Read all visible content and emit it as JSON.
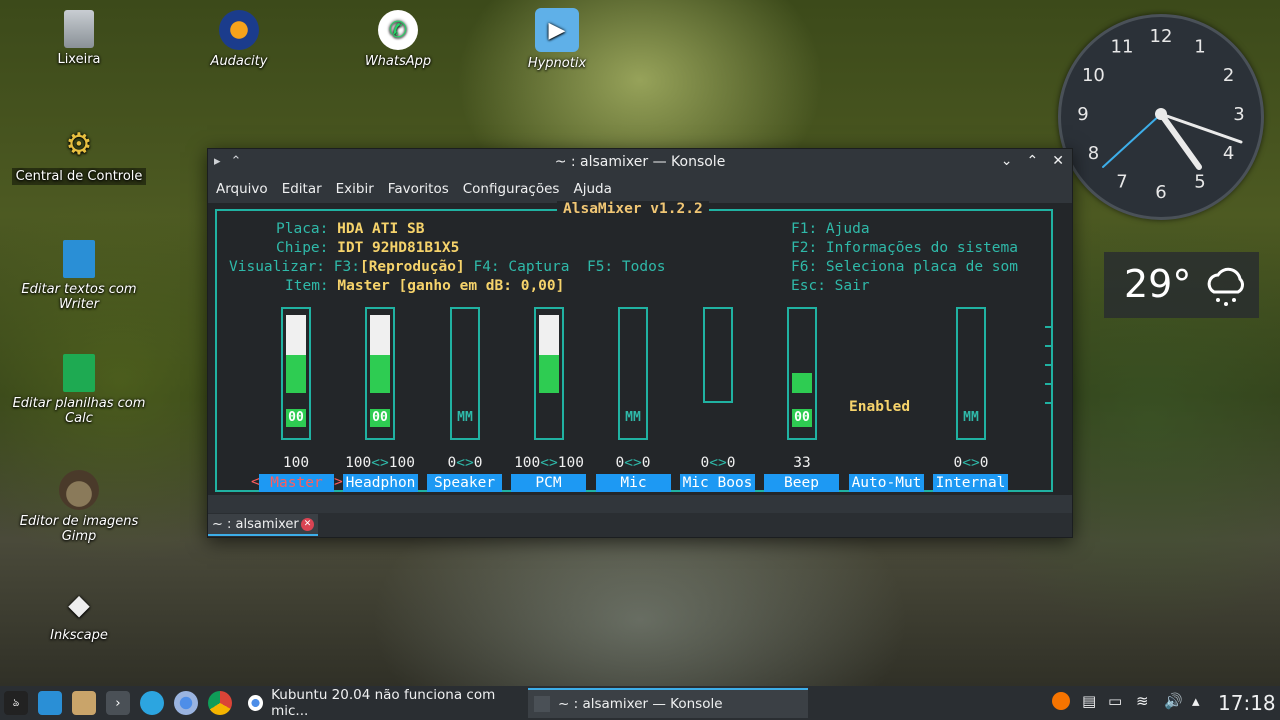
{
  "desktop": {
    "icons": [
      {
        "name": "trash",
        "label": "Lixeira"
      },
      {
        "name": "audacity",
        "label": "Audacity"
      },
      {
        "name": "whatsapp",
        "label": "WhatsApp"
      },
      {
        "name": "hypnotix",
        "label": "Hypnotix"
      },
      {
        "name": "control-center",
        "label": "Central de Controle"
      },
      {
        "name": "writer",
        "label": "Editar textos com Writer"
      },
      {
        "name": "calc",
        "label": "Editar planilhas com Calc"
      },
      {
        "name": "gimp",
        "label": "Editor de imagens Gimp"
      },
      {
        "name": "inkscape",
        "label": "Inkscape"
      }
    ]
  },
  "window": {
    "title": "~ : alsamixer — Konsole",
    "menu": [
      "Arquivo",
      "Editar",
      "Exibir",
      "Favoritos",
      "Configurações",
      "Ajuda"
    ],
    "tab_label": "~ : alsamixer"
  },
  "alsamixer": {
    "title": "AlsaMixer v1.2.2",
    "info": {
      "card_label": "Placa:",
      "card_value": "HDA ATI SB",
      "chip_label": "Chipe:",
      "chip_value": "IDT 92HD81B1X5",
      "view_label": "Visualizar:",
      "view_f3": "F3:",
      "view_f3_value": "[Reprodução]",
      "view_f4": "F4: Captura",
      "view_f5": "F5: Todos",
      "item_label": "Item:",
      "item_value": "Master [ganho em dB: 0,00]"
    },
    "help": [
      "F1: Ajuda",
      "F2: Informações do sistema",
      "F6: Seleciona placa de som",
      "Esc: Sair"
    ],
    "channels": [
      {
        "name": "Master",
        "volume": "100",
        "level": 1.0,
        "mute": "00",
        "muted": false,
        "selected": true
      },
      {
        "name": "Headphon",
        "volume_left": "100",
        "volume_right": "100",
        "level": 1.0,
        "mute": "00",
        "muted": false
      },
      {
        "name": "Speaker",
        "volume_left": "0",
        "volume_right": "0",
        "level": 0.0,
        "mute": "MM",
        "muted": true
      },
      {
        "name": "PCM",
        "volume_left": "100",
        "volume_right": "100",
        "level": 1.0,
        "mute": "",
        "muted": false
      },
      {
        "name": "Mic",
        "volume_left": "0",
        "volume_right": "0",
        "level": 0.0,
        "mute": "MM",
        "muted": true
      },
      {
        "name": "Mic Boos",
        "volume_left": "0",
        "volume_right": "0",
        "level": 0.0,
        "mute": "",
        "muted": false
      },
      {
        "name": "Beep",
        "volume": "33",
        "level": 0.33,
        "mute": "00",
        "muted": false
      },
      {
        "name": "Auto-Mut",
        "state": "Enabled"
      },
      {
        "name": "Internal",
        "volume_left": "0",
        "volume_right": "0",
        "level": 0.0,
        "mute": "MM",
        "muted": true
      }
    ],
    "arrow_sep": "<>",
    "left_arrow": "<",
    "right_arrow": ">"
  },
  "clock": {
    "numbers": [
      "12",
      "1",
      "2",
      "3",
      "4",
      "5",
      "6",
      "7",
      "8",
      "9",
      "10",
      "11"
    ]
  },
  "weather": {
    "temperature": "29°",
    "icon": "rain-cloud-icon"
  },
  "taskbar": {
    "tasks": [
      {
        "name": "chrome-task",
        "label": "Kubuntu 20.04 não funciona com mic..."
      },
      {
        "name": "konsole-task",
        "label": "~ : alsamixer — Konsole"
      }
    ],
    "time": "17:18"
  },
  "colors": {
    "accent": "#3daee9",
    "teal": "#20b2a2",
    "yellow": "#f6d36b",
    "green": "#2ecc52",
    "blue": "#1d99f3"
  }
}
